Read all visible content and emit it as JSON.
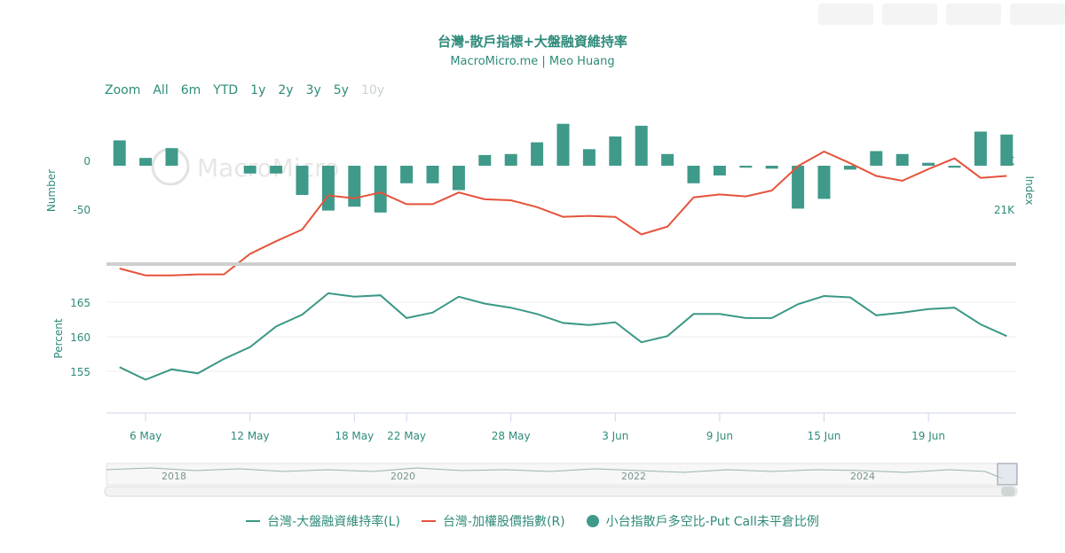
{
  "title": "台灣-散戶指標+大盤融資維持率",
  "subtitle": "MacroMicro.me | Meo Huang",
  "watermark": "MacroMicro",
  "zoom": {
    "label": "Zoom",
    "options": [
      "All",
      "6m",
      "YTD",
      "1y",
      "2y",
      "3y",
      "5y",
      "10y"
    ],
    "disabled": "10y"
  },
  "colors": {
    "accent": "#2e8b7a",
    "bar": "#3f9a8a",
    "index_line": "#e5533b",
    "margin_line": "#3b9886"
  },
  "axes": {
    "top_left_label": "Number",
    "top_right_label": "Index",
    "top_left_ticks": [
      "0",
      "-50"
    ],
    "top_right_ticks": [
      "K",
      "21K"
    ],
    "bottom_left_label": "Percent",
    "bottom_ticks": [
      "165",
      "160",
      "155"
    ],
    "x_ticks": [
      "6 May",
      "12 May",
      "18 May",
      "22 May",
      "28 May",
      "3 Jun",
      "9 Jun",
      "15 Jun",
      "19 Jun"
    ]
  },
  "navigator": {
    "years": [
      "2018",
      "2020",
      "2022",
      "2024"
    ]
  },
  "legend": [
    {
      "label": "台灣-大盤融資維持率(L)",
      "kind": "line",
      "color": "#3b9886"
    },
    {
      "label": "台灣-加權股價指數(R)",
      "kind": "line",
      "color": "#e5533b"
    },
    {
      "label": "小台指散戶多空比-Put Call未平倉比例",
      "kind": "dot",
      "color": "#3f9a8a"
    }
  ],
  "chart_data": [
    {
      "type": "bar",
      "series": [
        {
          "name": "小台指散戶多空比-Put Call未平倉比例",
          "x": [
            "May 3",
            "May 6",
            "May 7",
            "May 8",
            "May 9",
            "May 10",
            "May 13",
            "May 14",
            "May 15",
            "May 16",
            "May 17",
            "May 20",
            "May 21",
            "May 22",
            "May 23",
            "May 24",
            "May 27",
            "May 28",
            "May 29",
            "May 30",
            "May 31",
            "Jun 3",
            "Jun 4",
            "Jun 5",
            "Jun 6",
            "Jun 7",
            "Jun 11",
            "Jun 12",
            "Jun 13",
            "Jun 14",
            "Jun 17",
            "Jun 18",
            "Jun 19",
            "Jun 20",
            "Jun 21"
          ],
          "values": [
            26,
            8,
            18,
            0,
            0,
            -8,
            -8,
            -30,
            -46,
            -42,
            -48,
            -18,
            -18,
            -25,
            11,
            12,
            24,
            43,
            17,
            30,
            41,
            12,
            -18,
            -10,
            -2,
            -3,
            -44,
            -34,
            -4,
            15,
            12,
            3,
            -2,
            35,
            32
          ]
        }
      ],
      "ylim": [
        -70,
        45
      ]
    },
    {
      "type": "line",
      "series": [
        {
          "name": "台灣-加權股價指數(R)",
          "x": [
            "May 3",
            "May 6",
            "May 7",
            "May 8",
            "May 9",
            "May 10",
            "May 13",
            "May 14",
            "May 15",
            "May 16",
            "May 17",
            "May 20",
            "May 21",
            "May 22",
            "May 23",
            "May 24",
            "May 27",
            "May 28",
            "May 29",
            "May 30",
            "May 31",
            "Jun 3",
            "Jun 4",
            "Jun 5",
            "Jun 6",
            "Jun 7",
            "Jun 11",
            "Jun 12",
            "Jun 13",
            "Jun 14",
            "Jun 17",
            "Jun 18",
            "Jun 19",
            "Jun 20",
            "Jun 21"
          ],
          "values": [
            20400,
            20330,
            20330,
            20340,
            20340,
            20550,
            20680,
            20800,
            21150,
            21120,
            21180,
            21060,
            21060,
            21180,
            21110,
            21100,
            21030,
            20930,
            20940,
            20930,
            20750,
            20830,
            21130,
            21160,
            21140,
            21200,
            21450,
            21600,
            21480,
            21350,
            21300,
            21420,
            21530,
            21330,
            21350
          ]
        }
      ]
    },
    {
      "type": "line",
      "series": [
        {
          "name": "台灣-大盤融資維持率(L)",
          "x": [
            "May 3",
            "May 6",
            "May 7",
            "May 8",
            "May 9",
            "May 10",
            "May 13",
            "May 14",
            "May 15",
            "May 16",
            "May 17",
            "May 20",
            "May 21",
            "May 22",
            "May 23",
            "May 24",
            "May 27",
            "May 28",
            "May 29",
            "May 30",
            "May 31",
            "Jun 3",
            "Jun 4",
            "Jun 5",
            "Jun 6",
            "Jun 7",
            "Jun 11",
            "Jun 12",
            "Jun 13",
            "Jun 14",
            "Jun 17",
            "Jun 18",
            "Jun 19",
            "Jun 20",
            "Jun 21"
          ],
          "values": [
            155.6,
            153.8,
            155.3,
            154.7,
            156.8,
            158.5,
            161.5,
            163.2,
            166.3,
            165.8,
            166.0,
            162.7,
            163.5,
            165.8,
            164.8,
            164.2,
            163.3,
            162.0,
            161.7,
            162.1,
            159.2,
            160.1,
            163.3,
            163.3,
            162.7,
            162.7,
            164.7,
            165.9,
            165.7,
            163.1,
            163.5,
            164.0,
            164.2,
            161.8,
            160.1
          ]
        }
      ],
      "ylabel": "Percent",
      "ylim": [
        150,
        170
      ]
    }
  ]
}
